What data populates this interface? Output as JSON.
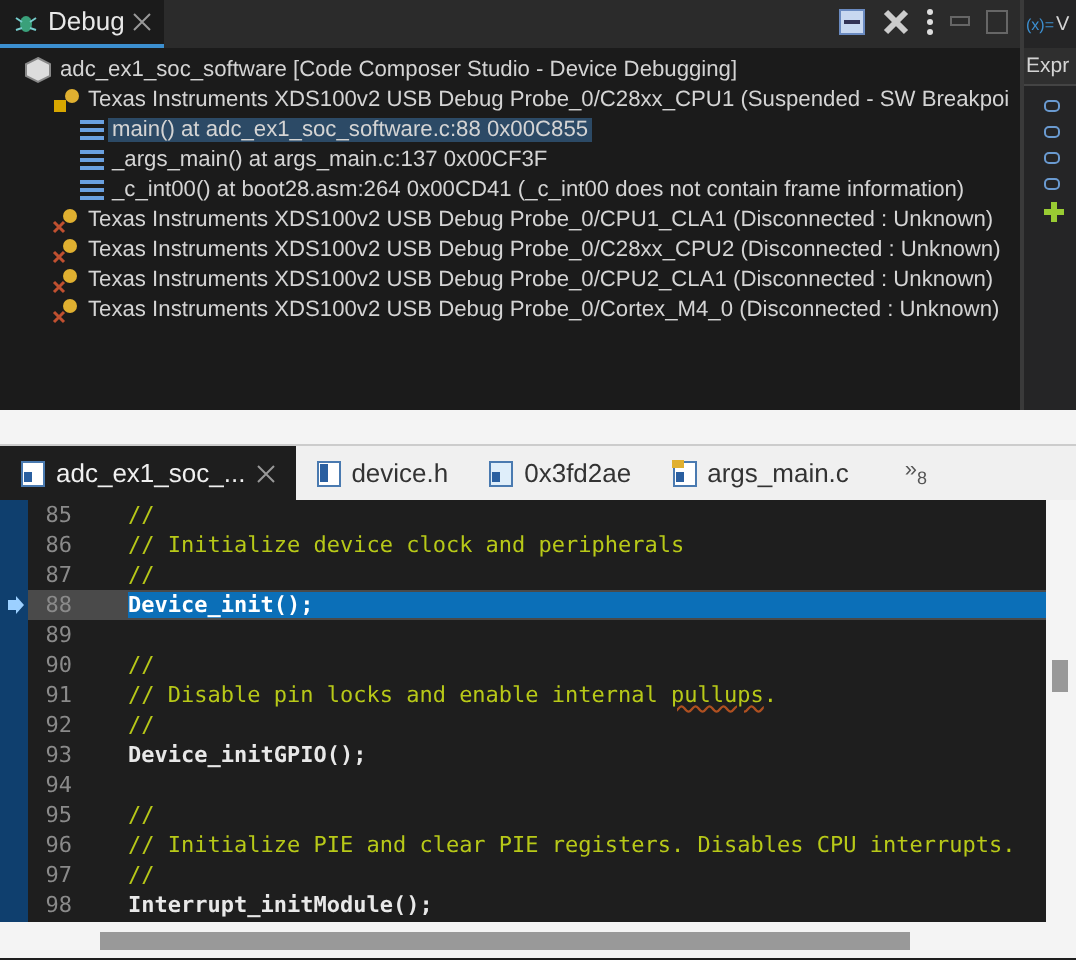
{
  "debug_view": {
    "title": "Debug",
    "tree": [
      {
        "label": "adc_ex1_soc_software [Code Composer Studio - Device Debugging]",
        "kind": "project",
        "selected": false,
        "children": [
          {
            "label": "Texas Instruments XDS100v2 USB Debug Probe_0/C28xx_CPU1 (Suspended - SW Breakpoi",
            "kind": "suspended",
            "selected": false,
            "children": [
              {
                "label": "main() at adc_ex1_soc_software.c:88 0x00C855",
                "kind": "frame",
                "selected": true
              },
              {
                "label": "_args_main() at args_main.c:137 0x00CF3F",
                "kind": "frame",
                "selected": false
              },
              {
                "label": "_c_int00() at boot28.asm:264 0x00CD41  (_c_int00 does not contain frame information)",
                "kind": "frame",
                "selected": false
              }
            ]
          },
          {
            "label": "Texas Instruments XDS100v2 USB Debug Probe_0/CPU1_CLA1 (Disconnected : Unknown)",
            "kind": "disconnected",
            "selected": false
          },
          {
            "label": "Texas Instruments XDS100v2 USB Debug Probe_0/C28xx_CPU2 (Disconnected : Unknown)",
            "kind": "disconnected",
            "selected": false
          },
          {
            "label": "Texas Instruments XDS100v2 USB Debug Probe_0/CPU2_CLA1 (Disconnected : Unknown)",
            "kind": "disconnected",
            "selected": false
          },
          {
            "label": "Texas Instruments XDS100v2 USB Debug Probe_0/Cortex_M4_0 (Disconnected : Unknown)",
            "kind": "disconnected",
            "selected": false
          }
        ]
      }
    ]
  },
  "side_view": {
    "tab_icon": "(x)=",
    "tab_title": "V",
    "column": "Expr"
  },
  "editor": {
    "tabs": [
      {
        "label": "adc_ex1_soc_...",
        "kind": "c",
        "selected": true
      },
      {
        "label": "device.h",
        "kind": "h",
        "selected": false
      },
      {
        "label": "0x3fd2ae",
        "kind": "disasm",
        "selected": false
      },
      {
        "label": "args_main.c",
        "kind": "cfolder",
        "selected": false
      }
    ],
    "overflow": {
      "icon": "»",
      "count": "8"
    },
    "lines": [
      {
        "number": "85",
        "kind": "comment",
        "text": "//",
        "current": false
      },
      {
        "number": "86",
        "kind": "comment",
        "text": "// Initialize device clock and peripherals",
        "current": false
      },
      {
        "number": "87",
        "kind": "comment",
        "text": "//",
        "current": false
      },
      {
        "number": "88",
        "kind": "code",
        "text": "Device_init();",
        "current": true
      },
      {
        "number": "89",
        "kind": "blank",
        "current": false
      },
      {
        "number": "90",
        "kind": "comment",
        "text": "//",
        "current": false
      },
      {
        "number": "91",
        "kind": "comment",
        "text": "// Disable pin locks and enable internal **pullups**.",
        "current": false
      },
      {
        "number": "92",
        "kind": "comment",
        "text": "//",
        "current": false
      },
      {
        "number": "93",
        "kind": "code",
        "text": "Device_initGPIO();",
        "current": false
      },
      {
        "number": "94",
        "kind": "blank",
        "current": false
      },
      {
        "number": "95",
        "kind": "comment",
        "text": "//",
        "current": false
      },
      {
        "number": "96",
        "kind": "comment",
        "text": "// Initialize PIE and clear PIE registers. Disables CPU interrupts.",
        "current": false
      },
      {
        "number": "97",
        "kind": "comment",
        "text": "//",
        "current": false
      },
      {
        "number": "98",
        "kind": "code",
        "text": "Interrupt_initModule();",
        "current": false
      }
    ]
  }
}
